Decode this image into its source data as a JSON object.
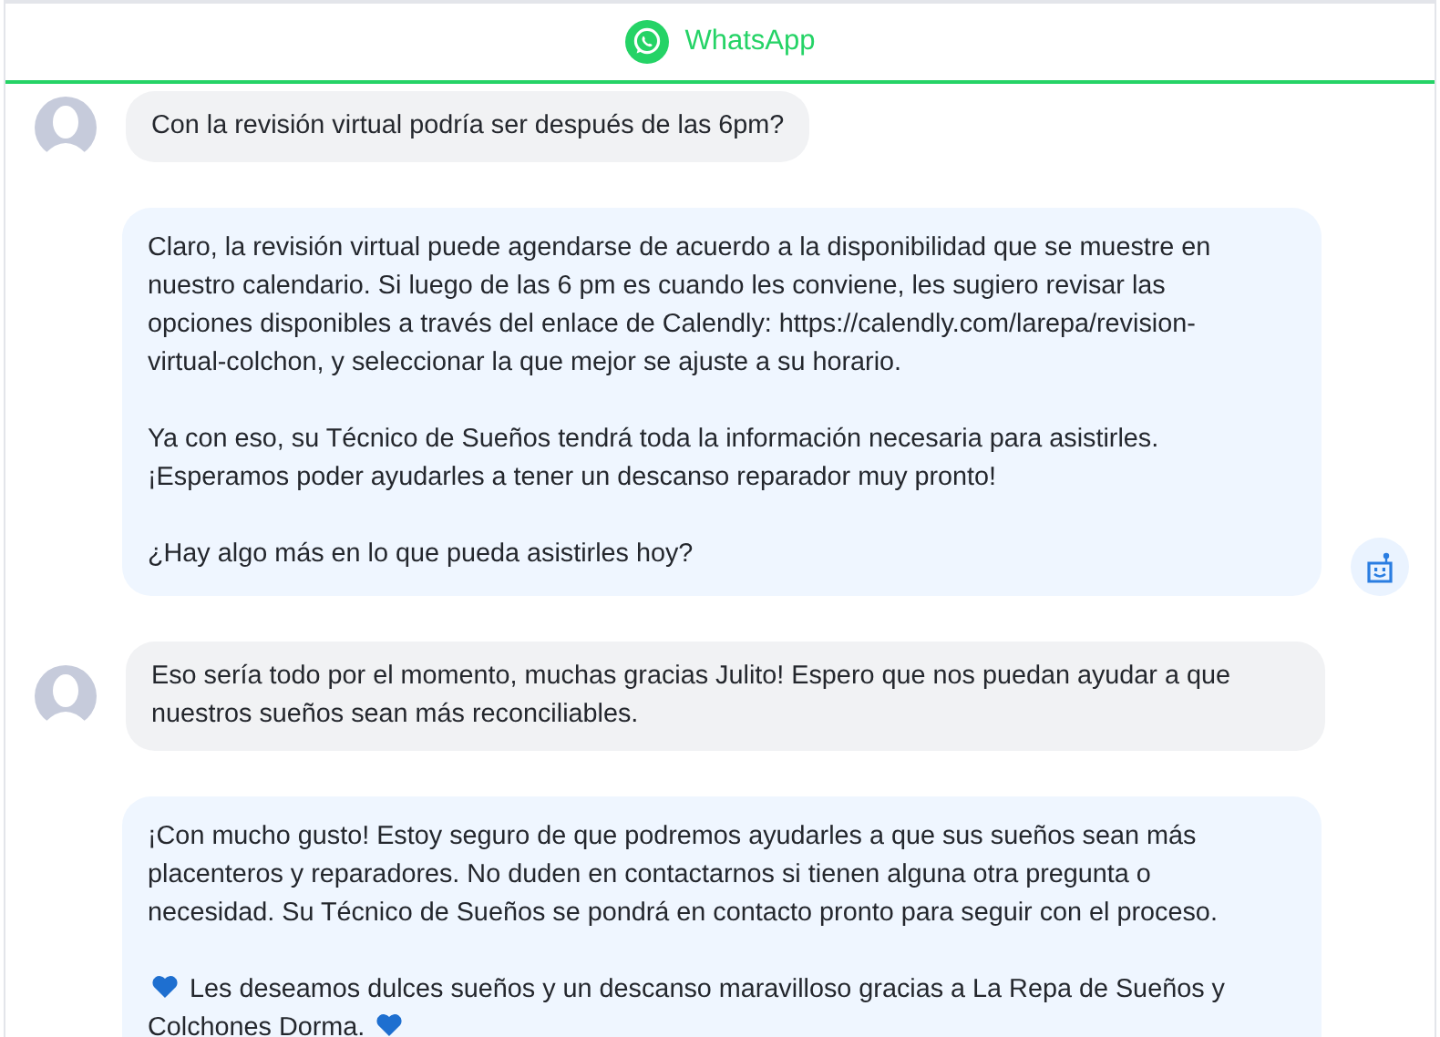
{
  "header": {
    "title": "WhatsApp"
  },
  "messages": [
    {
      "kind": "user",
      "paragraphs": [
        [
          {
            "kind": "text",
            "text": "Con la revisión virtual podría ser después de las 6pm?"
          }
        ]
      ]
    },
    {
      "kind": "bot",
      "show_bot_icon": true,
      "paragraphs": [
        [
          {
            "kind": "text",
            "text": "Claro, la revisión virtual puede agendarse de acuerdo a la disponibilidad que se muestre en nuestro calendario. Si luego de las 6 pm es cuando les conviene, les sugiero revisar las opciones disponibles a través del enlace de Calendly: https://calendly.com/larepa/revision-virtual-colchon, y seleccionar la que mejor se ajuste a su horario."
          }
        ],
        [
          {
            "kind": "text",
            "text": "Ya con eso, su Técnico de Sueños tendrá toda la información necesaria para asistirles. ¡Esperamos poder ayudarles a tener un descanso reparador muy pronto!"
          }
        ],
        [
          {
            "kind": "text",
            "text": "¿Hay algo más en lo que pueda asistirles hoy?"
          }
        ]
      ]
    },
    {
      "kind": "user",
      "paragraphs": [
        [
          {
            "kind": "text",
            "text": "Eso sería todo por el momento, muchas gracias Julito! Espero que nos puedan ayudar a que nuestros sueños sean más reconciliables."
          }
        ]
      ]
    },
    {
      "kind": "bot",
      "show_bot_icon": false,
      "paragraphs": [
        [
          {
            "kind": "text",
            "text": "¡Con mucho gusto! Estoy seguro de que podremos ayudarles a que sus sueños sean más placenteros y reparadores. No duden en contactarnos si tienen alguna otra pregunta o necesidad. Su Técnico de Sueños se pondrá en contacto pronto para seguir con el proceso."
          }
        ],
        [
          {
            "kind": "heart"
          },
          {
            "kind": "text",
            "text": " Les deseamos dulces sueños y un descanso maravilloso gracias a La Repa de Sueños y Colchones Dorma. "
          },
          {
            "kind": "heart"
          }
        ]
      ]
    }
  ]
}
